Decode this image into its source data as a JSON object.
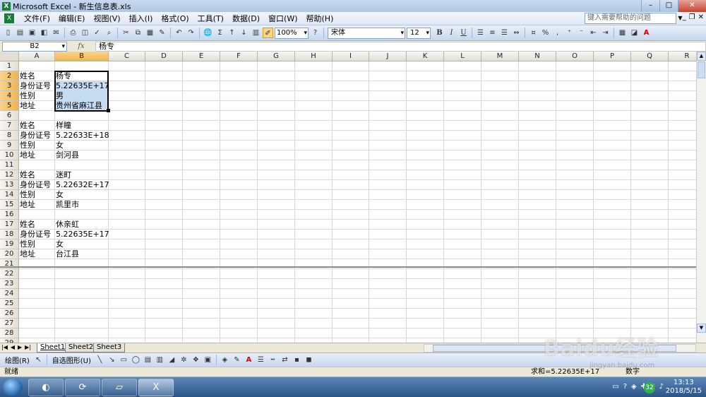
{
  "window": {
    "title": "Microsoft Excel - 新生信息表.xls",
    "minimize": "–",
    "maximize": "□",
    "close": "✕"
  },
  "menu": {
    "items": [
      "文件(F)",
      "编辑(E)",
      "视图(V)",
      "插入(I)",
      "格式(O)",
      "工具(T)",
      "数据(D)",
      "窗口(W)",
      "帮助(H)"
    ],
    "help_placeholder": "键入需要帮助的问题"
  },
  "toolbar": {
    "zoom": "100%",
    "font": "宋体",
    "font_size": "12",
    "bold": "B",
    "italic": "I",
    "underline": "U"
  },
  "formula_bar": {
    "cell_ref": "B2",
    "fx": "fx",
    "content": "杨专"
  },
  "grid": {
    "columns": [
      "A",
      "B",
      "C",
      "D",
      "E",
      "F",
      "G",
      "H",
      "I",
      "J",
      "K",
      "L",
      "M",
      "N",
      "O",
      "P",
      "Q",
      "R"
    ],
    "rows": [
      "1",
      "2",
      "3",
      "4",
      "5",
      "6",
      "7",
      "8",
      "9",
      "10",
      "11",
      "12",
      "13",
      "14",
      "15",
      "16",
      "17",
      "18",
      "19",
      "20",
      "21",
      "22",
      "23",
      "24",
      "25",
      "26",
      "27",
      "28",
      "29"
    ],
    "selected_column": "B",
    "selected_rows": [
      "2",
      "3",
      "4",
      "5"
    ],
    "records": [
      {
        "name_label": "姓名",
        "name": "杨专",
        "id_label": "身份证号",
        "id": "5.22635E+17",
        "sex_label": "性别",
        "sex": "男",
        "addr_label": "地址",
        "addr": "贵州省麻江县"
      },
      {
        "name_label": "姓名",
        "name": "样瞳",
        "id_label": "身份证号",
        "id": "5.22633E+18",
        "sex_label": "性别",
        "sex": "女",
        "addr_label": "地址",
        "addr": "剑河县"
      },
      {
        "name_label": "姓名",
        "name": "迷町",
        "id_label": "身份证号",
        "id": "5.22632E+17",
        "sex_label": "性别",
        "sex": "女",
        "addr_label": "地址",
        "addr": "凯里市"
      },
      {
        "name_label": "姓名",
        "name": "休亲虹",
        "id_label": "身份证号",
        "id": "5.22635E+17",
        "sex_label": "性别",
        "sex": "女",
        "addr_label": "地址",
        "addr": "台江县"
      }
    ]
  },
  "sheets": {
    "tabs": [
      "Sheet1",
      "Sheet2",
      "Sheet3"
    ],
    "active": "Sheet1"
  },
  "draw_toolbar": {
    "draw": "绘图(R)",
    "autoshapes": "自选图形(U)"
  },
  "status": {
    "ready": "就绪",
    "sum": "求和=5.22635E+17",
    "num": "数字"
  },
  "taskbar": {
    "excel_label": "X",
    "tray_badge": "32",
    "time": "13:13",
    "date": "2018/5/15"
  },
  "watermark": {
    "text": "Baidu经验",
    "sub": "jingyan.baidu.com"
  }
}
